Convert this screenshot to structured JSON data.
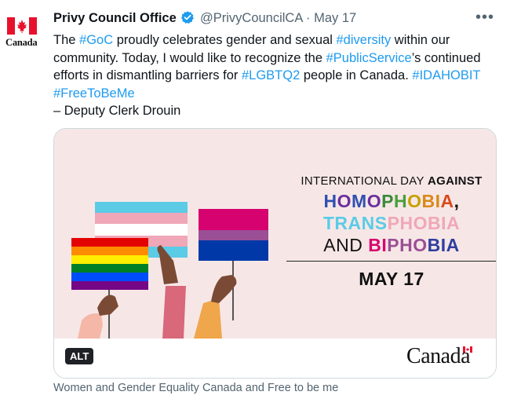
{
  "account": {
    "avatar_word": "Canada",
    "name": "Privy Council Office",
    "handle": "@PrivyCouncilCA",
    "separator": "·",
    "date": "May 17",
    "more_icon": "more-horizontal-icon"
  },
  "tweet": {
    "p1": "The ",
    "t1": "#GoC",
    "p2": " proudly celebrates gender and sexual ",
    "t2": "#diversity",
    "p3": " within our community. Today, I would like to recognize the ",
    "t3": "#PublicService",
    "p4": "’s continued efforts in dismantling barriers for ",
    "t4": "#LGBTQ2",
    "p5": " people in Canada. ",
    "t5": "#IDAHOBIT",
    "t6": "#FreeToBeMe",
    "signature": "– Deputy Clerk Drouin"
  },
  "media": {
    "line1_normal": "INTERNATIONAL DAY ",
    "line1_bold": "AGAINST",
    "homo": [
      {
        "ch": "H",
        "color": "#2f4fb0"
      },
      {
        "ch": "O",
        "color": "#6a2fa0"
      },
      {
        "ch": "M",
        "color": "#2f4fb0"
      },
      {
        "ch": "O",
        "color": "#6a2fa0"
      },
      {
        "ch": "P",
        "color": "#3a8a3a"
      },
      {
        "ch": "H",
        "color": "#4a9e3a"
      },
      {
        "ch": "O",
        "color": "#c8a000"
      },
      {
        "ch": "B",
        "color": "#d9891a"
      },
      {
        "ch": "I",
        "color": "#d9891a"
      },
      {
        "ch": "A",
        "color": "#d94a1a"
      },
      {
        "ch": ",",
        "color": "#111111"
      }
    ],
    "trans": [
      {
        "ch": "T",
        "color": "#5bcbe6"
      },
      {
        "ch": "R",
        "color": "#5bcbe6"
      },
      {
        "ch": "A",
        "color": "#5bcbe6"
      },
      {
        "ch": "N",
        "color": "#5bcbe6"
      },
      {
        "ch": "S",
        "color": "#5bcbe6"
      },
      {
        "ch": "P",
        "color": "#f0a7b8"
      },
      {
        "ch": "H",
        "color": "#f0a7b8"
      },
      {
        "ch": "O",
        "color": "#f0a7b8"
      },
      {
        "ch": "B",
        "color": "#f0a7b8"
      },
      {
        "ch": "I",
        "color": "#f0a7b8"
      },
      {
        "ch": "A",
        "color": "#f0a7b8"
      }
    ],
    "and_word": "AND ",
    "bi": [
      {
        "ch": "B",
        "color": "#d60270"
      },
      {
        "ch": "I",
        "color": "#d60270"
      },
      {
        "ch": "P",
        "color": "#9b4f96"
      },
      {
        "ch": "H",
        "color": "#9b4f96"
      },
      {
        "ch": "O",
        "color": "#9b4f96"
      },
      {
        "ch": "B",
        "color": "#2f3fa0"
      },
      {
        "ch": "I",
        "color": "#2f3fa0"
      },
      {
        "ch": "A",
        "color": "#2f3fa0"
      }
    ],
    "date": "MAY 17",
    "background_color": "#f6e7e6"
  },
  "card": {
    "alt_label": "ALT",
    "wordmark": "Canada"
  },
  "caption": "Women and Gender Equality Canada and Free to be me"
}
